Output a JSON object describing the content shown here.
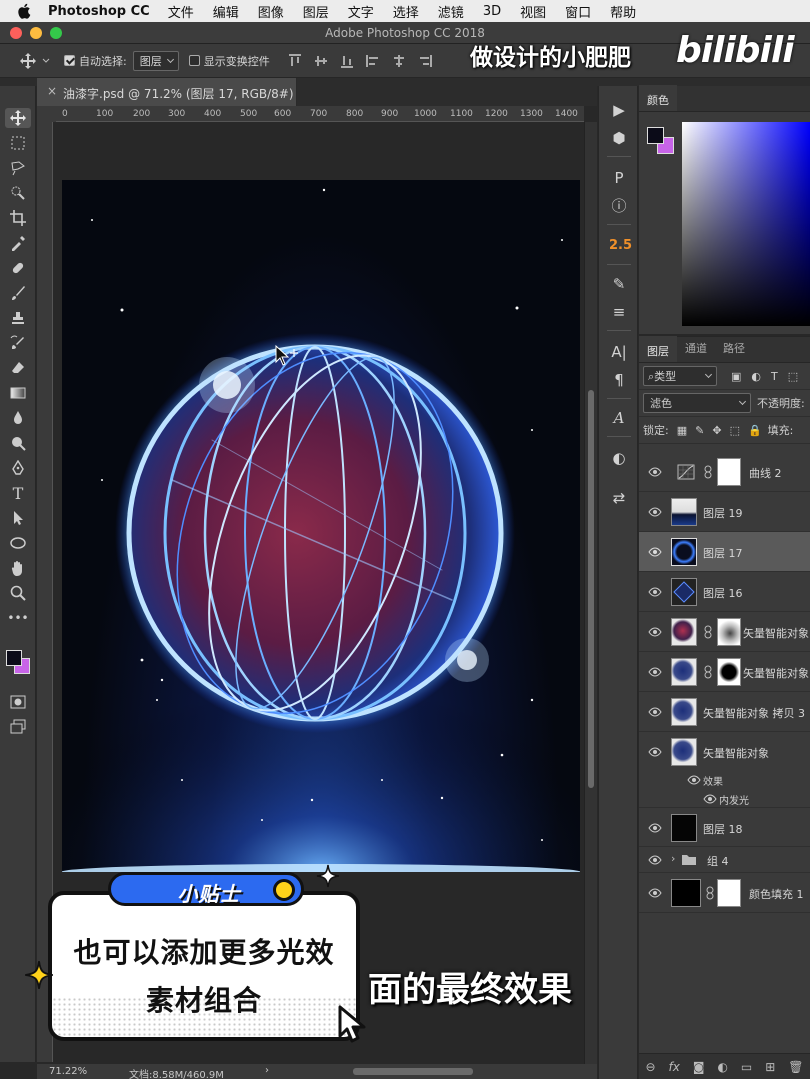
{
  "menubar": {
    "app_name": "Photoshop CC",
    "items": [
      "文件",
      "编辑",
      "图像",
      "图层",
      "文字",
      "选择",
      "滤镜",
      "3D",
      "视图",
      "窗口",
      "帮助"
    ]
  },
  "window": {
    "title": "Adobe Photoshop CC 2018"
  },
  "options": {
    "auto_select_label": "自动选择:",
    "auto_select_value": "图层",
    "show_transform_label": "显示变换控件"
  },
  "watermark": {
    "text": "做设计的小肥肥",
    "brand": "bilibili"
  },
  "document": {
    "tab_title": "油漆字.psd @ 71.2% (图层 17, RGB/8#) *",
    "ruler_ticks": [
      "0",
      "100",
      "200",
      "300",
      "400",
      "500",
      "600",
      "700",
      "800",
      "900",
      "1000",
      "1100",
      "1200",
      "1300",
      "1400"
    ]
  },
  "status": {
    "zoom": "71.22%",
    "doc_size": "文档:8.58M/460.9M",
    "arrow": "›"
  },
  "iconcol": {
    "number_badge": "2.5"
  },
  "color_panel": {
    "tab": "颜色",
    "fg_color": "#0b0b18",
    "bg_color": "#c864e8"
  },
  "layers_panel": {
    "tabs": [
      "图层",
      "通道",
      "路径"
    ],
    "filter_kind": "类型",
    "blend_mode": "滤色",
    "opacity_label": "不透明度:",
    "lock_label": "锁定:",
    "fill_label": "填充:",
    "layers": [
      {
        "name": "曲线 2",
        "thumb": "adjust",
        "mask": true
      },
      {
        "name": "图层 19",
        "thumb": "gradient-dark",
        "mask": false
      },
      {
        "name": "图层 17",
        "thumb": "ring",
        "mask": false,
        "selected": true
      },
      {
        "name": "图层 16",
        "thumb": "diamond",
        "mask": false
      },
      {
        "name": "矢量智能对象",
        "thumb": "smart",
        "mask": true
      },
      {
        "name": "矢量智能对象",
        "thumb": "smart",
        "mask": true
      },
      {
        "name": "矢量智能对象 拷贝 3",
        "thumb": "smart",
        "mask": false
      },
      {
        "name": "矢量智能对象",
        "thumb": "smart",
        "mask": false
      }
    ],
    "effects_label": "效果",
    "inner_glow_label": "内发光",
    "layer18": "图层 18",
    "group4": "组 4",
    "fill1": "颜色填充 1"
  },
  "tip": {
    "tag": "小贴士",
    "line1": "也可以添加更多光效",
    "line2": "素材组合"
  },
  "subtitle": "面的最终效果"
}
